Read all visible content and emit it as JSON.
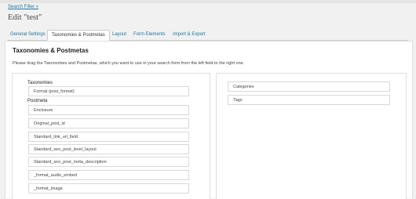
{
  "breadcrumb": "Search Filter »",
  "page_title": "Edit \"test\"",
  "tabs": [
    {
      "label": "General Settings"
    },
    {
      "label": "Taxonomies & Postmetas"
    },
    {
      "label": "Layout"
    },
    {
      "label": "Form Elements"
    },
    {
      "label": "Import & Export"
    }
  ],
  "active_tab": "Taxonomies & Postmetas",
  "section": {
    "title": "Taxonomies & Postmetas",
    "instructions": "Please drag the Taxonomies and Postmetas, which you want to use in your search form from the left field to the right one."
  },
  "available": {
    "taxonomies_label": "Taxonomies",
    "taxonomies": [
      "Format (post_format)"
    ],
    "postmeta_label": "Postmeta",
    "postmeta": [
      "Enclosure",
      "Original_post_id",
      "Standard_link_url_field",
      "Standard_seo_post_level_layout",
      "Standard_seo_post_meta_description",
      "_format_audio_embed",
      "_format_image"
    ]
  },
  "selected": [
    "Categories",
    "Tags"
  ]
}
